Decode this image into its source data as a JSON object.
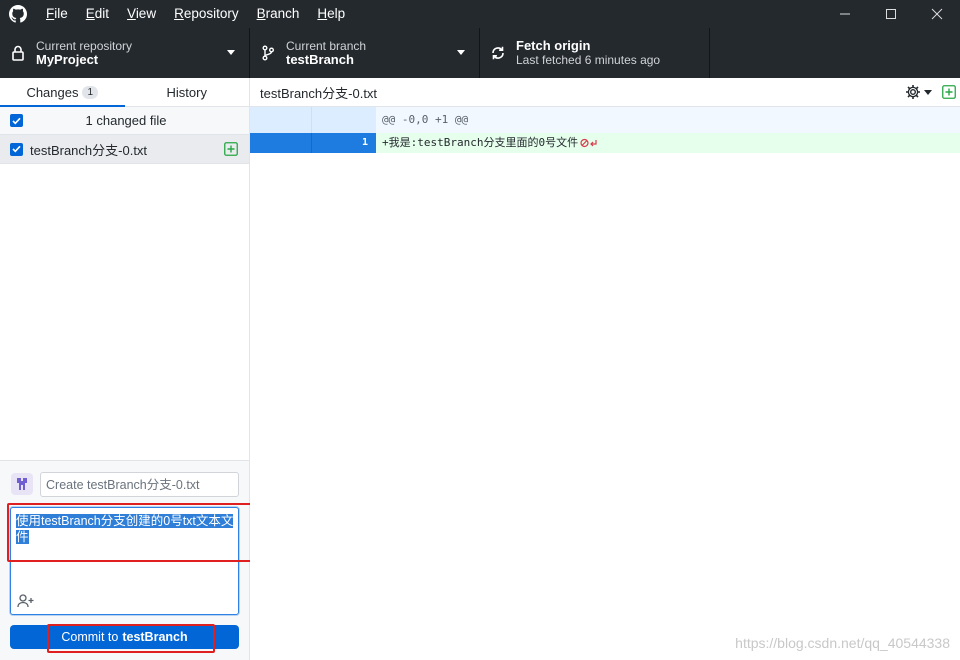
{
  "menu": [
    {
      "mnemonic": "F",
      "rest": "ile"
    },
    {
      "mnemonic": "E",
      "rest": "dit"
    },
    {
      "mnemonic": "V",
      "rest": "iew"
    },
    {
      "mnemonic": "R",
      "rest": "epository"
    },
    {
      "mnemonic": "B",
      "rest": "ranch"
    },
    {
      "mnemonic": "H",
      "rest": "elp"
    }
  ],
  "toolbar": {
    "repo_label": "Current repository",
    "repo_value": "MyProject",
    "branch_label": "Current branch",
    "branch_value": "testBranch",
    "fetch_title": "Fetch origin",
    "fetch_sub": "Last fetched 6 minutes ago"
  },
  "sidebar": {
    "tab_changes": "Changes",
    "tab_changes_count": "1",
    "tab_history": "History",
    "changed_count_label": "1 changed file",
    "file_name": "testBranch分支-0.txt"
  },
  "commit": {
    "summary_placeholder": "Create testBranch分支-0.txt",
    "description": "使用testBranch分支创建的0号txt文本文件",
    "button_prefix": "Commit to",
    "button_branch": "testBranch"
  },
  "diff": {
    "file_name": "testBranch分支-0.txt",
    "hunk_header": "@@ -0,0 +1 @@",
    "added_line_number": "1",
    "added_line_text": "+我是:testBranch分支里面的0号文件"
  },
  "watermark": "https://blog.csdn.net/qq_40544338",
  "colors": {
    "accent": "#0366d6",
    "titlebar": "#24292e",
    "highlight_box": "#e02020",
    "added_bg": "#e6ffed"
  }
}
